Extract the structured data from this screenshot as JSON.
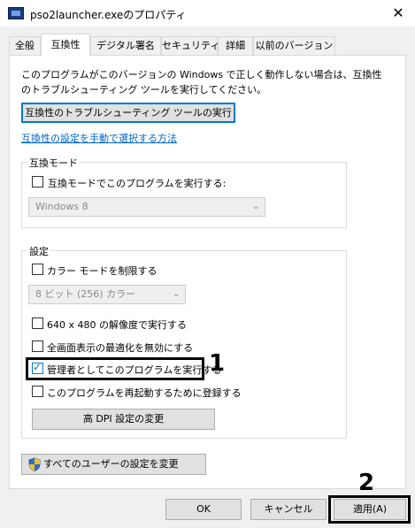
{
  "window": {
    "title": "pso2launcher.exeのプロパティ",
    "close_glyph": "✕"
  },
  "tabs": [
    {
      "label": "全般"
    },
    {
      "label": "互換性"
    },
    {
      "label": "デジタル署名"
    },
    {
      "label": "セキュリティ"
    },
    {
      "label": "詳細"
    },
    {
      "label": "以前のバージョン"
    }
  ],
  "description": {
    "line1": "このプログラムがこのバージョンの Windows で正しく動作しない場合は、互換性",
    "line2": "のトラブルシューティング ツールを実行してください。"
  },
  "troubleshooter_button": "互換性のトラブルシューティング ツールの実行",
  "manual_link": "互換性の設定を手動で選択する方法",
  "compat_mode": {
    "legend": "互換モード",
    "checkbox_label": "互換モードでこのプログラムを実行する:",
    "checked": false,
    "select_value": "Windows 8"
  },
  "settings": {
    "legend": "設定",
    "color_mode_label": "カラー モードを制限する",
    "color_select_value": "8 ビット (256) カラー",
    "resolution_label": "640 x 480 の解像度で実行する",
    "fullscreen_label": "全画面表示の最適化を無効にする",
    "admin_label": "管理者としてこのプログラムを実行する",
    "admin_checked": true,
    "restart_label": "このプログラムを再起動するために登録する",
    "dpi_button": "高 DPI 設定の変更"
  },
  "all_users_button": "すべてのユーザーの設定を変更",
  "footer": {
    "ok": "OK",
    "cancel": "キャンセル",
    "apply": "適用(A)"
  },
  "annotations": {
    "step1": "1",
    "step2": "2"
  },
  "icons": {
    "dropdown": "chevron-down-icon",
    "shield": "uac-shield-icon",
    "checkmark": "checkmark-icon"
  }
}
